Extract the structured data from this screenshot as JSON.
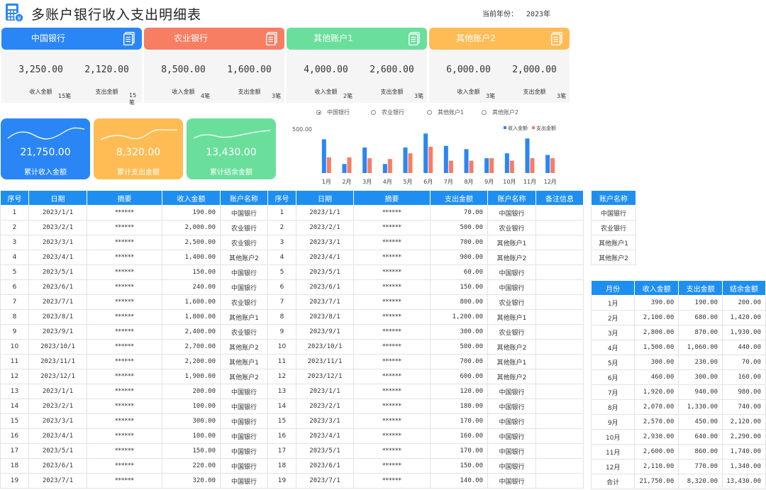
{
  "header": {
    "title": "多账户银行收入支出明细表",
    "year_label": "当前年份：",
    "year_value": "2023年"
  },
  "accounts": [
    {
      "name": "中国银行",
      "color": "#2b86f5",
      "income": "3,250.00",
      "expense": "2,120.00",
      "income_label": "收入金额",
      "expense_label": "支出金额",
      "income_count": "15笔",
      "expense_count": "15笔"
    },
    {
      "name": "农业银行",
      "color": "#f77d63",
      "income": "8,500.00",
      "expense": "1,600.00",
      "income_label": "收入金额",
      "expense_label": "支出金额",
      "income_count": "4笔",
      "expense_count": "3笔"
    },
    {
      "name": "其他账户1",
      "color": "#6adf9c",
      "income": "4,000.00",
      "expense": "2,600.00",
      "income_label": "收入金额",
      "expense_label": "支出金额",
      "income_count": "2笔",
      "expense_count": "3笔"
    },
    {
      "name": "其他账户2",
      "color": "#ffbc55",
      "income": "6,000.00",
      "expense": "2,000.00",
      "income_label": "收入金额",
      "expense_label": "支出金额",
      "income_count": "3笔",
      "expense_count": "3笔"
    }
  ],
  "summary": [
    {
      "value": "21,750.00",
      "label": "累计收入金额",
      "color": "#2b86f5"
    },
    {
      "value": "8,320.00",
      "label": "累计支出金额",
      "color": "#ffbc55"
    },
    {
      "value": "13,430.00",
      "label": "累计结余金额",
      "color": "#6adf9c"
    }
  ],
  "chart_options": [
    "中国银行",
    "农业银行",
    "其他账户1",
    "其他账户2"
  ],
  "chart_selected": "中国银行",
  "chart_data": {
    "type": "bar",
    "categories": [
      "1月",
      "2月",
      "3月",
      "4月",
      "5月",
      "6月",
      "7月",
      "8月",
      "9月",
      "10月",
      "11月",
      "12月"
    ],
    "series": [
      {
        "name": "收入金额",
        "color": "#2b86f5",
        "values": [
          410,
          110,
          310,
          110,
          310,
          480,
          330,
          290,
          180,
          240,
          420,
          220
        ]
      },
      {
        "name": "支出金额",
        "color": "#f77d63",
        "values": [
          190,
          190,
          180,
          170,
          240,
          320,
          150,
          150,
          180,
          150,
          180,
          180
        ]
      }
    ],
    "yticks": [
      "500.00",
      ""
    ],
    "ylim": [
      0,
      500
    ],
    "legend": "top-right"
  },
  "income_table": {
    "headers": [
      "序号",
      "日期",
      "摘要",
      "收入金额",
      "账户名称"
    ],
    "rows": [
      [
        "1",
        "2023/1/1",
        "******",
        "190.00",
        "中国银行"
      ],
      [
        "2",
        "2023/2/1",
        "******",
        "2,000.00",
        "农业银行"
      ],
      [
        "3",
        "2023/3/1",
        "******",
        "2,500.00",
        "农业银行"
      ],
      [
        "4",
        "2023/4/1",
        "******",
        "1,400.00",
        "其他账户2"
      ],
      [
        "5",
        "2023/5/1",
        "******",
        "150.00",
        "中国银行"
      ],
      [
        "6",
        "2023/6/1",
        "******",
        "240.00",
        "中国银行"
      ],
      [
        "7",
        "2023/7/1",
        "******",
        "1,600.00",
        "农业银行"
      ],
      [
        "8",
        "2023/8/1",
        "******",
        "1,800.00",
        "其他账户1"
      ],
      [
        "9",
        "2023/9/1",
        "******",
        "2,400.00",
        "农业银行"
      ],
      [
        "10",
        "2023/10/1",
        "******",
        "2,700.00",
        "其他账户2"
      ],
      [
        "11",
        "2023/11/1",
        "******",
        "2,200.00",
        "其他账户1"
      ],
      [
        "12",
        "2023/12/1",
        "******",
        "1,900.00",
        "其他账户2"
      ],
      [
        "13",
        "2023/1/1",
        "******",
        "200.00",
        "中国银行"
      ],
      [
        "14",
        "2023/2/1",
        "******",
        "100.00",
        "中国银行"
      ],
      [
        "15",
        "2023/3/1",
        "******",
        "300.00",
        "中国银行"
      ],
      [
        "16",
        "2023/4/1",
        "******",
        "100.00",
        "中国银行"
      ],
      [
        "17",
        "2023/5/1",
        "******",
        "150.00",
        "中国银行"
      ],
      [
        "18",
        "2023/6/1",
        "******",
        "220.00",
        "中国银行"
      ],
      [
        "19",
        "2023/7/1",
        "******",
        "320.00",
        "中国银行"
      ]
    ]
  },
  "expense_table": {
    "headers": [
      "序号",
      "日期",
      "摘要",
      "支出金额",
      "账户名称",
      "备注信息"
    ],
    "rows": [
      [
        "1",
        "2023/1/1",
        "******",
        "70.00",
        "中国银行",
        ""
      ],
      [
        "2",
        "2023/2/1",
        "******",
        "500.00",
        "农业银行",
        ""
      ],
      [
        "3",
        "2023/3/1",
        "******",
        "700.00",
        "其他账户1",
        ""
      ],
      [
        "4",
        "2023/4/1",
        "******",
        "900.00",
        "其他账户2",
        ""
      ],
      [
        "5",
        "2023/5/1",
        "******",
        "60.00",
        "中国银行",
        ""
      ],
      [
        "6",
        "2023/6/1",
        "******",
        "150.00",
        "中国银行",
        ""
      ],
      [
        "7",
        "2023/7/1",
        "******",
        "800.00",
        "农业银行",
        ""
      ],
      [
        "8",
        "2023/8/1",
        "******",
        "1,200.00",
        "其他账户1",
        ""
      ],
      [
        "9",
        "2023/9/1",
        "******",
        "300.00",
        "农业银行",
        ""
      ],
      [
        "10",
        "2023/10/1",
        "******",
        "500.00",
        "其他账户2",
        ""
      ],
      [
        "11",
        "2023/11/1",
        "******",
        "700.00",
        "其他账户1",
        ""
      ],
      [
        "12",
        "2023/12/1",
        "******",
        "600.00",
        "其他账户2",
        ""
      ],
      [
        "13",
        "2023/1/1",
        "******",
        "120.00",
        "中国银行",
        ""
      ],
      [
        "14",
        "2023/2/1",
        "******",
        "180.00",
        "中国银行",
        ""
      ],
      [
        "15",
        "2023/3/1",
        "******",
        "170.00",
        "中国银行",
        ""
      ],
      [
        "16",
        "2023/4/1",
        "******",
        "160.00",
        "中国银行",
        ""
      ],
      [
        "17",
        "2023/5/1",
        "******",
        "170.00",
        "中国银行",
        ""
      ],
      [
        "18",
        "2023/6/1",
        "******",
        "150.00",
        "中国银行",
        ""
      ],
      [
        "19",
        "2023/7/1",
        "******",
        "140.00",
        "中国银行",
        ""
      ]
    ]
  },
  "account_list": {
    "header": "账户名称",
    "items": [
      "中国银行",
      "农业银行",
      "其他账户1",
      "其他账户2"
    ]
  },
  "monthly_table": {
    "headers": [
      "月份",
      "收入金额",
      "支出金额",
      "结余金额"
    ],
    "rows": [
      [
        "1月",
        "390.00",
        "190.00",
        "200.00"
      ],
      [
        "2月",
        "2,100.00",
        "680.00",
        "1,420.00"
      ],
      [
        "3月",
        "2,800.00",
        "870.00",
        "1,930.00"
      ],
      [
        "4月",
        "1,500.00",
        "1,060.00",
        "440.00"
      ],
      [
        "5月",
        "300.00",
        "230.00",
        "70.00"
      ],
      [
        "6月",
        "460.00",
        "300.00",
        "160.00"
      ],
      [
        "7月",
        "1,920.00",
        "940.00",
        "980.00"
      ],
      [
        "8月",
        "2,070.00",
        "1,330.00",
        "740.00"
      ],
      [
        "9月",
        "2,570.00",
        "450.00",
        "2,120.00"
      ],
      [
        "10月",
        "2,930.00",
        "640.00",
        "2,290.00"
      ],
      [
        "11月",
        "2,600.00",
        "860.00",
        "1,740.00"
      ],
      [
        "12月",
        "2,110.00",
        "770.00",
        "1,340.00"
      ],
      [
        "合计",
        "21,750.00",
        "8,320.00",
        "13,430.00"
      ]
    ]
  }
}
